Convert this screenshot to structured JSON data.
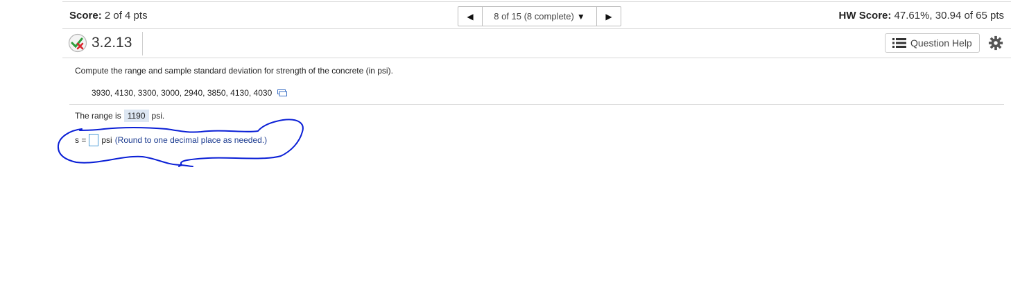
{
  "header": {
    "score_label": "Score:",
    "score_value": "2 of 4 pts",
    "nav_text": "8 of 15 (8 complete)",
    "hw_score_label": "HW Score:",
    "hw_score_value": "47.61%, 30.94 of 65 pts"
  },
  "question": {
    "number": "3.2.13",
    "help_label": "Question Help",
    "prompt": "Compute the range and sample standard deviation for strength of the concrete (in psi).",
    "data": "3930, 4130, 3300, 3000, 2940, 3850, 4130, 4030",
    "range_prefix": "The range is",
    "range_value": "1190",
    "range_suffix": "psi.",
    "s_prefix": "s =",
    "s_value": "",
    "s_suffix": "psi",
    "s_hint": "(Round to one decimal place as needed.)"
  },
  "colors": {
    "check_green": "#2e9e3a",
    "cross_red": "#d9262e",
    "scribble_blue": "#0a1fd6",
    "input_border": "#4a9bd6",
    "hint_blue": "#1a3a8f"
  },
  "icons": [
    "status-partial-icon",
    "prev-arrow-icon",
    "dropdown-caret-icon",
    "next-arrow-icon",
    "list-icon",
    "gear-icon",
    "data-copy-icon"
  ]
}
